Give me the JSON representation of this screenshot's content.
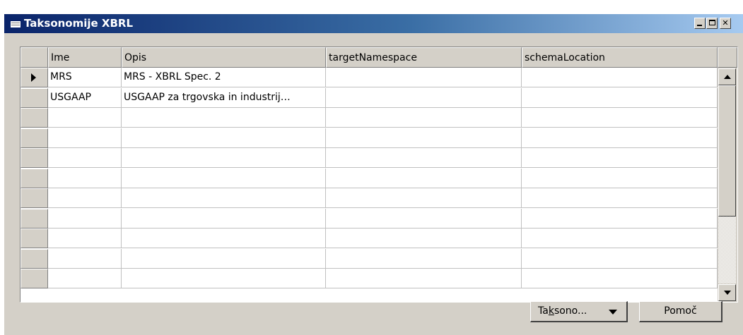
{
  "window": {
    "title": "Taksonomije XBRL",
    "title_icon": "table-window-icon",
    "titlebar_colors": [
      "#0a246a",
      "#a6caf0"
    ]
  },
  "grid": {
    "columns": [
      "Ime",
      "Opis",
      "targetNamespace",
      "schemaLocation"
    ],
    "rows": [
      {
        "ime": "MRS",
        "opis": "MRS - XBRL Spec. 2",
        "targetNamespace": "",
        "schemaLocation": "",
        "current": true
      },
      {
        "ime": "USGAAP",
        "opis": "USGAAP za trgovska in industrij…",
        "targetNamespace": "",
        "schemaLocation": "",
        "current": false
      },
      {
        "ime": "",
        "opis": "",
        "targetNamespace": "",
        "schemaLocation": "",
        "current": false
      },
      {
        "ime": "",
        "opis": "",
        "targetNamespace": "",
        "schemaLocation": "",
        "current": false
      },
      {
        "ime": "",
        "opis": "",
        "targetNamespace": "",
        "schemaLocation": "",
        "current": false
      },
      {
        "ime": "",
        "opis": "",
        "targetNamespace": "",
        "schemaLocation": "",
        "current": false
      },
      {
        "ime": "",
        "opis": "",
        "targetNamespace": "",
        "schemaLocation": "",
        "current": false
      },
      {
        "ime": "",
        "opis": "",
        "targetNamespace": "",
        "schemaLocation": "",
        "current": false
      },
      {
        "ime": "",
        "opis": "",
        "targetNamespace": "",
        "schemaLocation": "",
        "current": false
      },
      {
        "ime": "",
        "opis": "",
        "targetNamespace": "",
        "schemaLocation": "",
        "current": false
      },
      {
        "ime": "",
        "opis": "",
        "targetNamespace": "",
        "schemaLocation": "",
        "current": false
      }
    ]
  },
  "buttons": {
    "taksonomije_label": "Taksono...",
    "pomoc_label": "Pomoč"
  }
}
